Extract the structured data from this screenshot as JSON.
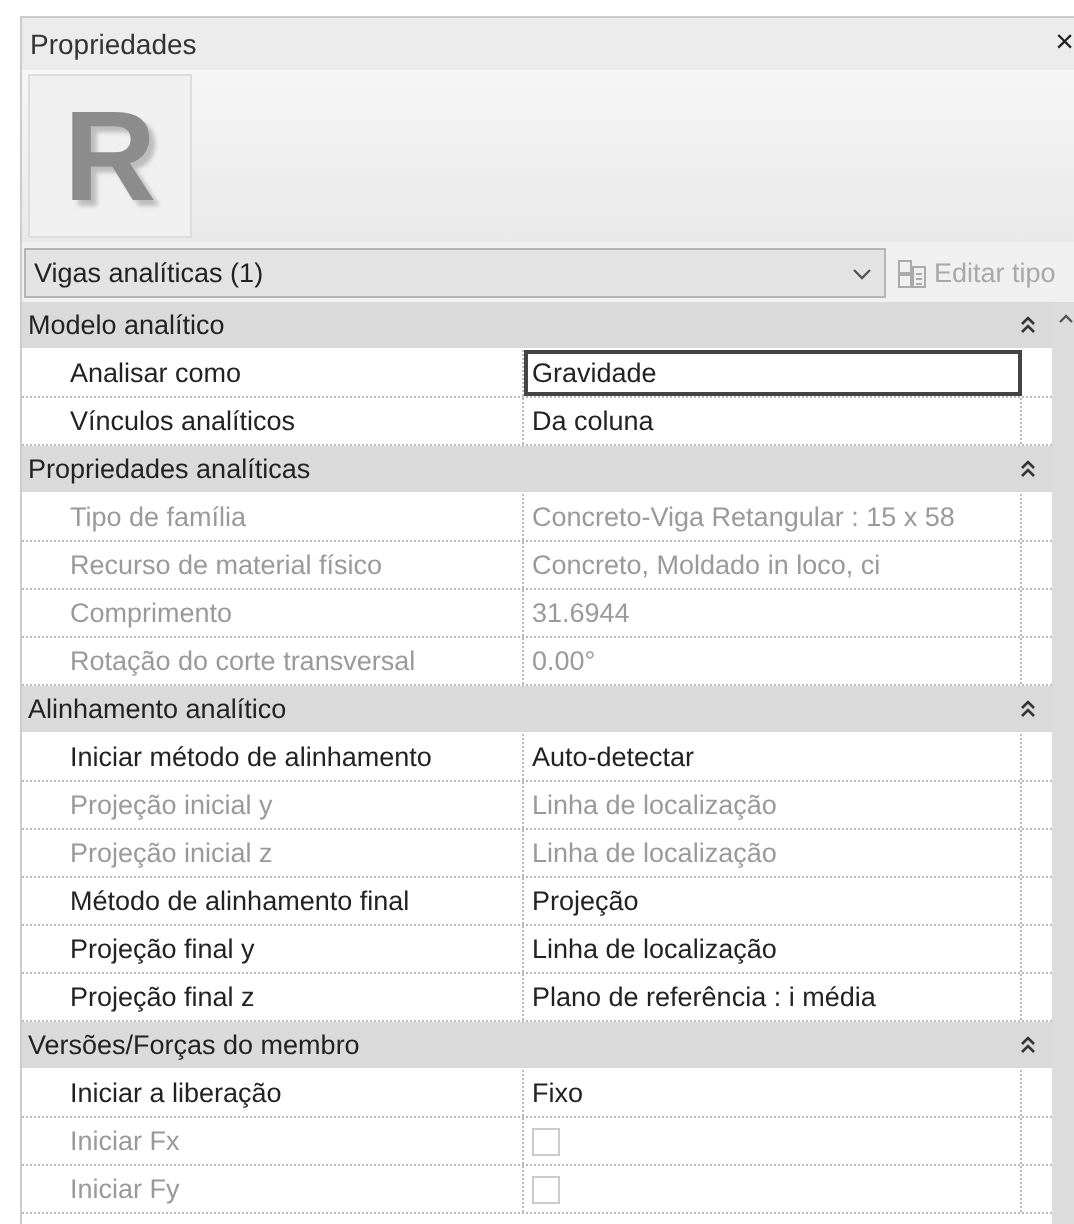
{
  "panel": {
    "title": "Propriedades",
    "close": "×"
  },
  "preview": {
    "logo": "R"
  },
  "type_selector": {
    "value": "Vigas analíticas (1)"
  },
  "edit_type": {
    "label": "Editar tipo",
    "disabled": true
  },
  "sections": [
    {
      "title": "Modelo analítico",
      "expanded": true,
      "rows": [
        {
          "kind": "text",
          "label": "Analisar como",
          "value": "Gravidade",
          "disabled": false,
          "focused": true
        },
        {
          "kind": "text",
          "label": "Vínculos analíticos",
          "value": "Da coluna",
          "disabled": false,
          "focused": false
        }
      ]
    },
    {
      "title": "Propriedades analíticas",
      "expanded": true,
      "rows": [
        {
          "kind": "text",
          "label": "Tipo de família",
          "value": "Concreto-Viga Retangular : 15 x 58",
          "disabled": true,
          "focused": false
        },
        {
          "kind": "text",
          "label": "Recurso de material físico",
          "value": "Concreto, Moldado in loco, ci",
          "disabled": true,
          "focused": false
        },
        {
          "kind": "text",
          "label": "Comprimento",
          "value": "31.6944",
          "disabled": true,
          "focused": false
        },
        {
          "kind": "text",
          "label": "Rotação do corte transversal",
          "value": "0.00°",
          "disabled": true,
          "focused": false
        }
      ]
    },
    {
      "title": "Alinhamento analítico",
      "expanded": true,
      "rows": [
        {
          "kind": "text",
          "label": "Iniciar método de alinhamento",
          "value": "Auto-detectar",
          "disabled": false,
          "focused": false
        },
        {
          "kind": "text",
          "label": "Projeção inicial y",
          "value": "Linha de localização",
          "disabled": true,
          "focused": false
        },
        {
          "kind": "text",
          "label": "Projeção inicial z",
          "value": "Linha de localização",
          "disabled": true,
          "focused": false
        },
        {
          "kind": "text",
          "label": "Método de alinhamento final",
          "value": "Projeção",
          "disabled": false,
          "focused": false
        },
        {
          "kind": "text",
          "label": "Projeção final y",
          "value": "Linha de localização",
          "disabled": false,
          "focused": false
        },
        {
          "kind": "text",
          "label": "Projeção final z",
          "value": "Plano de referência : i média",
          "disabled": false,
          "focused": false
        }
      ]
    },
    {
      "title": "Versões/Forças do membro",
      "expanded": true,
      "rows": [
        {
          "kind": "text",
          "label": "Iniciar a liberação",
          "value": "Fixo",
          "disabled": false,
          "focused": false
        },
        {
          "kind": "checkbox",
          "label": "Iniciar Fx",
          "checked": false,
          "disabled": true
        },
        {
          "kind": "checkbox",
          "label": "Iniciar Fy",
          "checked": false,
          "disabled": true
        }
      ]
    }
  ]
}
